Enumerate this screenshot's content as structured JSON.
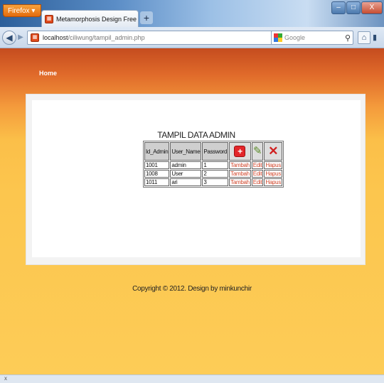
{
  "browser": {
    "menu_button": "Firefox ▾",
    "tab_title": "Metamorphosis Design Free Css Templa...",
    "new_tab": "+",
    "window_buttons": [
      "–",
      "□",
      "X"
    ],
    "url_host": "localhost",
    "url_path": "/ciliwung/tampil_admin.php",
    "search_placeholder": "Google",
    "status_close": "x"
  },
  "page": {
    "nav_home": "Home",
    "table_title": "TAMPIL DATA ADMIN",
    "headers": [
      "Id_Admin",
      "User_Name",
      "Password"
    ],
    "rows": [
      {
        "id": "1001",
        "user": "admin",
        "password": "1",
        "add": "Tambah",
        "edit": "Edit",
        "delete": "Hapus"
      },
      {
        "id": "1008",
        "user": "User",
        "password": "2",
        "add": "Tambah",
        "edit": "Edit",
        "delete": "Hapus"
      },
      {
        "id": "1011",
        "user": "ari",
        "password": "3",
        "add": "Tambah",
        "edit": "Edit",
        "delete": "Hapus"
      }
    ],
    "copyright": "Copyright © 2012. Design by minkunchir"
  },
  "icons": {
    "add": "add-icon",
    "edit": "pencil-icon",
    "delete": "cross-icon"
  },
  "colors": {
    "header_top": "#c54c1f",
    "background": "#fdcc57",
    "link": "#d0452a"
  }
}
